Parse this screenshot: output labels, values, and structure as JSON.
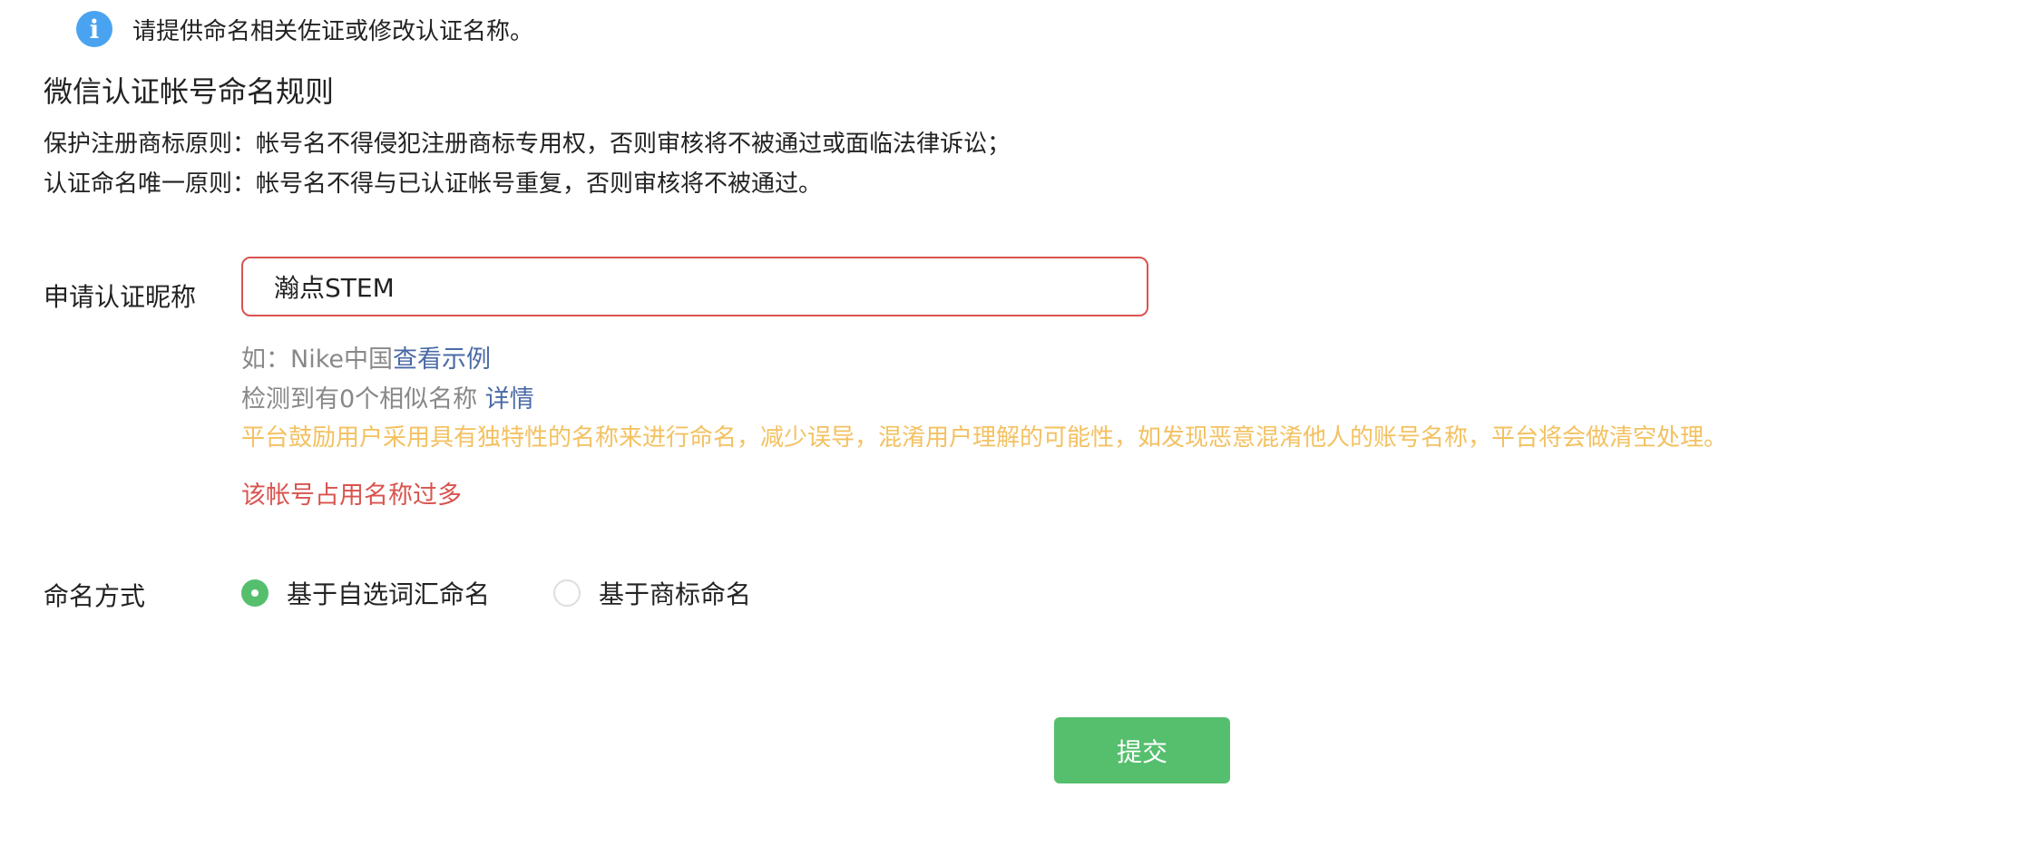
{
  "notice": {
    "icon": "info-icon",
    "icon_glyph": "i",
    "text": "请提供命名相关佐证或修改认证名称。",
    "icon_color": "#4aa3f0"
  },
  "rules": {
    "title": "微信认证帐号命名规则",
    "lines": [
      "保护注册商标原则：帐号名不得侵犯注册商标专用权，否则审核将不被通过或面临法律诉讼；",
      "认证命名唯一原则：帐号名不得与已认证帐号重复，否则审核将不被通过。"
    ]
  },
  "nickname_field": {
    "label": "申请认证昵称",
    "value": "瀚点STEM",
    "example_prefix": "如：Nike中国",
    "example_link": "查看示例",
    "similar_prefix": "检测到有0个相似名称",
    "similar_link": "详情",
    "warning": "平台鼓励用户采用具有独特性的名称来进行命名，减少误导，混淆用户理解的可能性，如发现恶意混淆他人的账号名称，平台将会做清空处理。",
    "error": "该帐号占用名称过多",
    "error_color": "#d9534f",
    "warning_color": "#f3c161"
  },
  "naming_method": {
    "label": "命名方式",
    "options": [
      {
        "label": "基于自选词汇命名",
        "selected": true
      },
      {
        "label": "基于商标命名",
        "selected": false
      }
    ]
  },
  "submit": {
    "label": "提交",
    "color": "#55bf6e"
  }
}
